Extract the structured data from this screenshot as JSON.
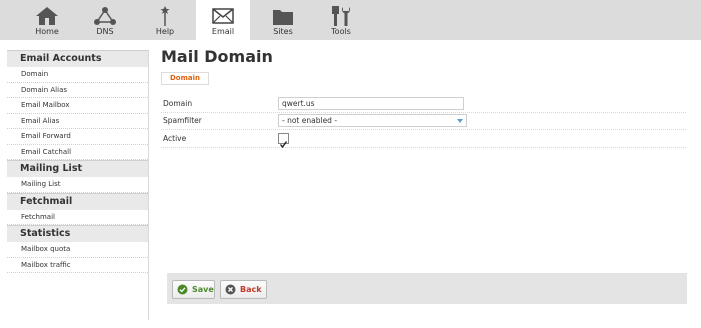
{
  "topnav": {
    "tabs": [
      {
        "label": "Home",
        "icon": "home-icon"
      },
      {
        "label": "DNS",
        "icon": "dns-icon"
      },
      {
        "label": "Help",
        "icon": "help-icon"
      },
      {
        "label": "Email",
        "icon": "email-icon",
        "active": true
      },
      {
        "label": "Sites",
        "icon": "sites-icon"
      },
      {
        "label": "Tools",
        "icon": "tools-icon"
      }
    ]
  },
  "sidebar": {
    "sections": [
      {
        "title": "Email Accounts",
        "items": [
          "Domain",
          "Domain Alias",
          "Email Mailbox",
          "Email Alias",
          "Email Forward",
          "Email Catchall"
        ]
      },
      {
        "title": "Mailing List",
        "items": [
          "Mailing List"
        ]
      },
      {
        "title": "Fetchmail",
        "items": [
          "Fetchmail"
        ]
      },
      {
        "title": "Statistics",
        "items": [
          "Mailbox quota",
          "Mailbox traffic"
        ]
      }
    ]
  },
  "main": {
    "title": "Mail Domain",
    "subtab": "Domain",
    "form": {
      "domain_label": "Domain",
      "domain_value": "qwert.us",
      "spamfilter_label": "Spamfilter",
      "spamfilter_value": "- not enabled -",
      "active_label": "Active",
      "active_checked": true
    },
    "buttons": {
      "save": "Save",
      "back": "Back"
    }
  },
  "colors": {
    "accent_orange": "#e06010",
    "save_green": "#4a8a2a",
    "back_red": "#c0392b",
    "select_arrow": "#5a9fd4"
  }
}
